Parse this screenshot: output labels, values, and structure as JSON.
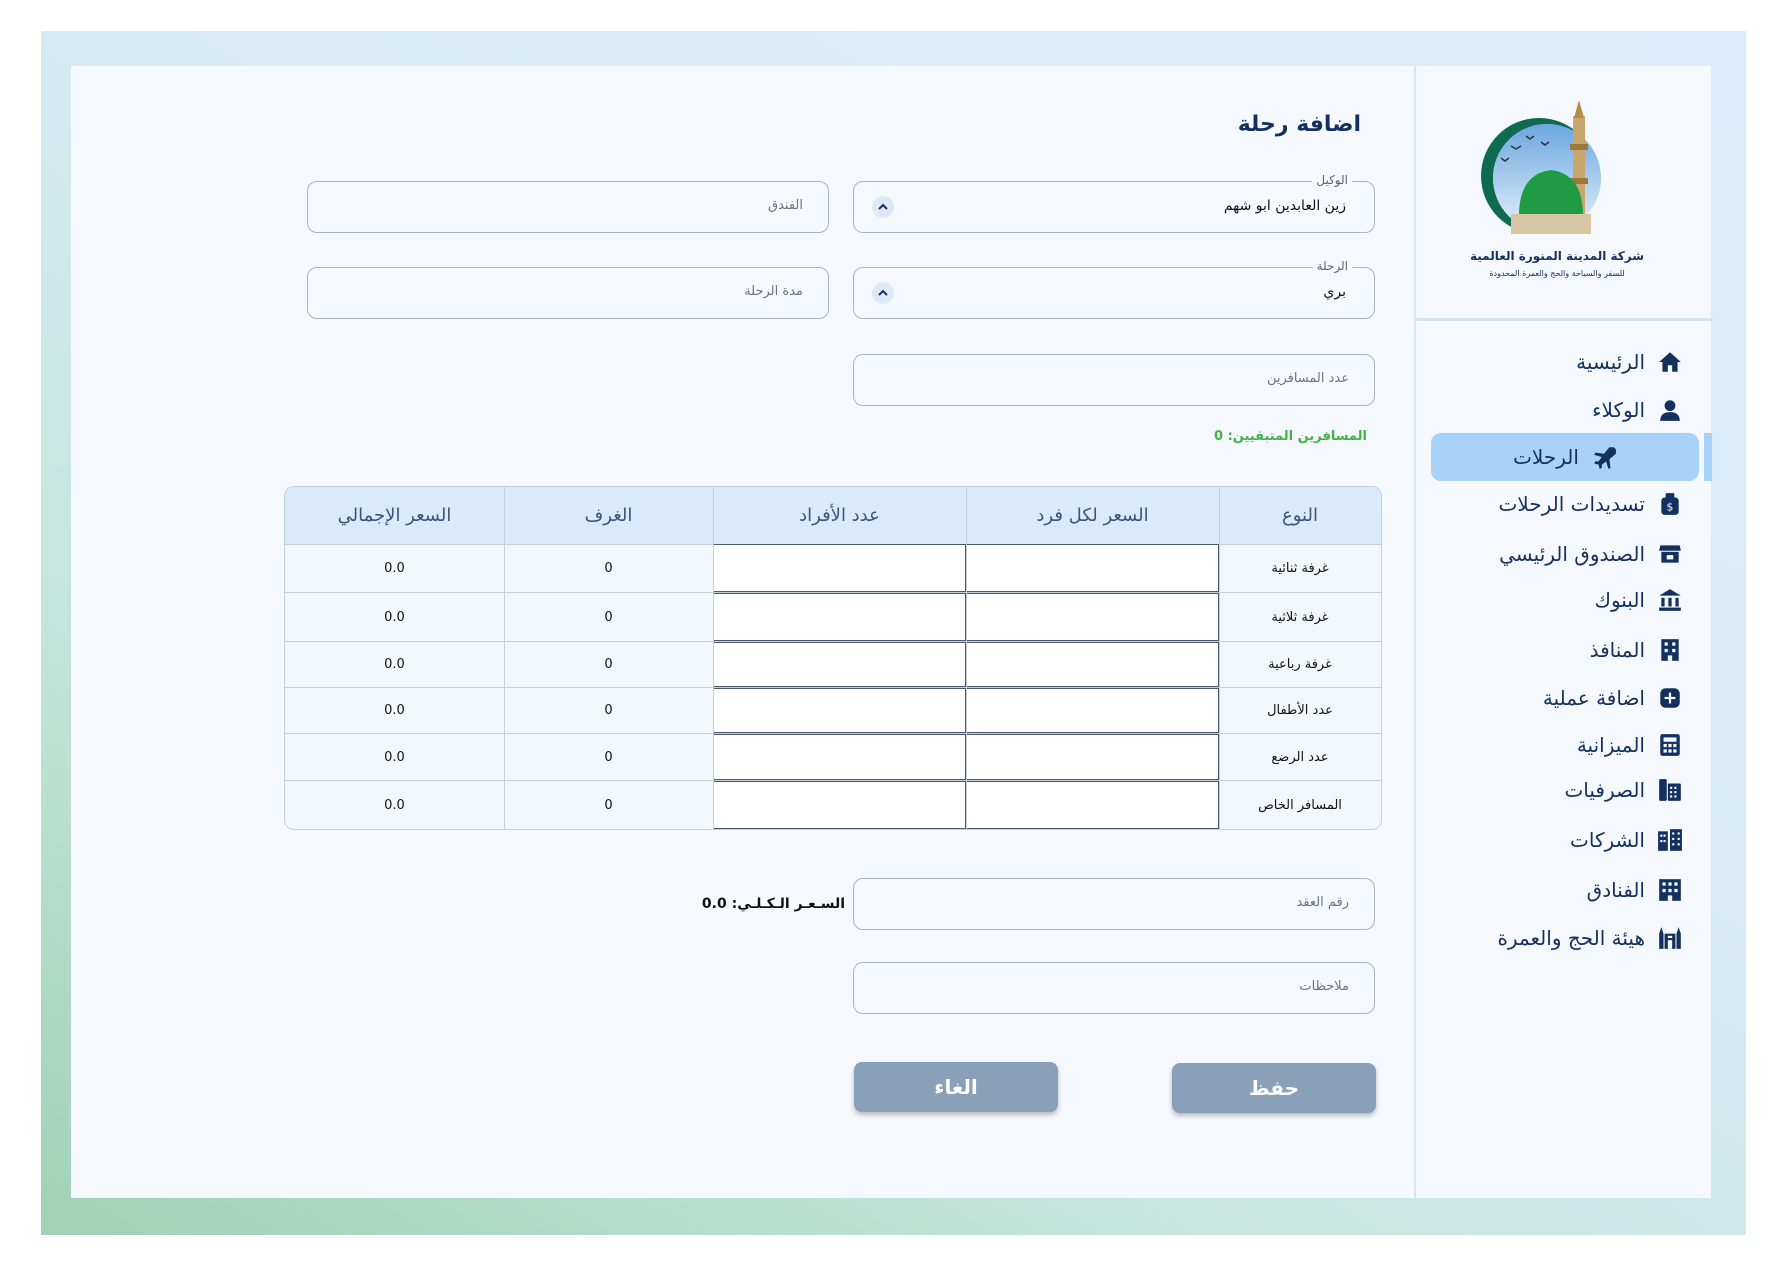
{
  "page": {
    "title": "اضافة رحلة"
  },
  "company": {
    "name": "شركة المدينة المنورة العالمية",
    "tagline": "للسفر والسياحة والحج والعمرة المحدودة"
  },
  "sidebar": {
    "items": [
      {
        "label": "الرئيسية",
        "icon": "home-icon"
      },
      {
        "label": "الوكلاء",
        "icon": "agent-icon"
      },
      {
        "label": "الرحلات",
        "icon": "airplane-icon",
        "active": true
      },
      {
        "label": "تسديدات الرحلات",
        "icon": "money-bag-icon"
      },
      {
        "label": "الصندوق الرئيسي",
        "icon": "cash-box-icon"
      },
      {
        "label": "البنوك",
        "icon": "bank-icon"
      },
      {
        "label": "المنافذ",
        "icon": "building-icon"
      },
      {
        "label": "اضافة عملية",
        "icon": "plus-square-icon"
      },
      {
        "label": "الميزانية",
        "icon": "calculator-icon"
      },
      {
        "label": "الصرفيات",
        "icon": "cash-register-icon"
      },
      {
        "label": "الشركات",
        "icon": "buildings-icon"
      },
      {
        "label": "الفنادق",
        "icon": "hotel-icon"
      },
      {
        "label": "هيئة الحج والعمرة",
        "icon": "kaaba-icon"
      }
    ]
  },
  "form": {
    "agent": {
      "legend": "الوكيل",
      "value": "زين العابدين ابو شهم"
    },
    "hotel": {
      "placeholder": "الفندق"
    },
    "trip": {
      "legend": "الرحلة",
      "value": "بري"
    },
    "duration": {
      "placeholder": "مدة الرحلة"
    },
    "travelers": {
      "placeholder": "عدد المسافرين"
    },
    "remaining": "المسافرين المتبقيين: 0",
    "contract": {
      "placeholder": "رقم العقد"
    },
    "notes": {
      "placeholder": "ملاحظات"
    },
    "total_price": "السـعـر الـكـلـي: 0.0"
  },
  "table": {
    "headers": [
      "النوع",
      "السعر لكل فرد",
      "عدد الأفراد",
      "الغرف",
      "السعر الإجمالي"
    ],
    "rows": [
      {
        "type": "غرفة ثنائية",
        "rooms": "0",
        "total": "0.0"
      },
      {
        "type": "غرفة ثلاثية",
        "rooms": "0",
        "total": "0.0"
      },
      {
        "type": "غرفة رباعية",
        "rooms": "0",
        "total": "0.0"
      },
      {
        "type": "عدد الأطفال",
        "rooms": "0",
        "total": "0.0"
      },
      {
        "type": "عدد الرضع",
        "rooms": "0",
        "total": "0.0"
      },
      {
        "type": "المسافر الخاص",
        "rooms": "0",
        "total": "0.0"
      }
    ]
  },
  "buttons": {
    "save": "حفظ",
    "cancel": "الغاء"
  },
  "colors": {
    "accent": "#a8d3f8",
    "navy": "#14305e",
    "button": "#8aa0b8",
    "success": "#43b049"
  }
}
